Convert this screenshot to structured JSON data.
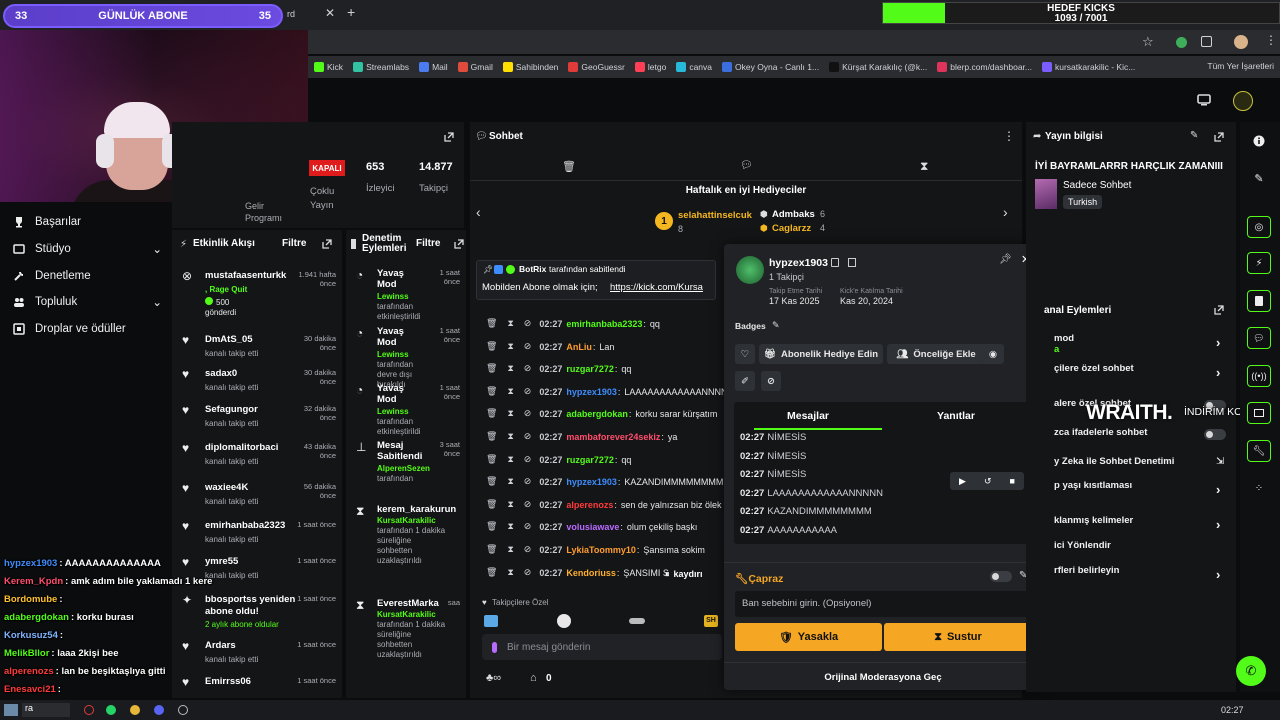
{
  "overlay": {
    "sub_goal": {
      "left": "33",
      "label": "GÜNLÜK ABONE",
      "right": "35"
    },
    "kick_goal": {
      "title": "HEDEF KICKS",
      "value": "1093 / 7001",
      "progress": 0.156,
      "color": "#53fc18"
    },
    "wraith": "WRAITH.",
    "discount": "İNDİRİM KOD"
  },
  "browser": {
    "tab_fragment": "rd",
    "bookmarks": [
      {
        "label": "Kick",
        "color": "#53fc18"
      },
      {
        "label": "Streamlabs",
        "color": "#31c3a2"
      },
      {
        "label": "Mail",
        "color": "#4a7cf0"
      },
      {
        "label": "Gmail",
        "color": "#e04b3b"
      },
      {
        "label": "Sahibinden",
        "color": "#ffe000"
      },
      {
        "label": "GeoGuessr",
        "color": "#e03b3b"
      },
      {
        "label": "letgo",
        "color": "#ff3f55"
      },
      {
        "label": "canva",
        "color": "#27b9d8"
      },
      {
        "label": "Okey Oyna - Canlı 1...",
        "color": "#3b6fe0"
      },
      {
        "label": "Kürşat Karakılıç (@k...",
        "color": "#111111"
      },
      {
        "label": "blerp.com/dashboar...",
        "color": "#e0335c"
      },
      {
        "label": "kursatkarakilic - Kic...",
        "color": "#7b5cff"
      }
    ],
    "all_bookmarks": "Tüm Yer İşaretleri"
  },
  "left_nav": {
    "items": [
      {
        "label": "Başarılar"
      },
      {
        "label": "Stüdyo"
      },
      {
        "label": "Denetleme"
      },
      {
        "label": "Topluluk"
      },
      {
        "label": "Droplar ve ödüller"
      }
    ]
  },
  "stats": {
    "status": "KAPALI",
    "viewers_value": "653",
    "viewers_label": "İzleyici",
    "followers_value": "14.877",
    "followers_label": "Takipçi",
    "income_l1": "Gelir",
    "income_l2": "Programı",
    "multi_l1": "Çoklu",
    "multi_l2": "Yayın"
  },
  "activity": {
    "title": "Etkinlik Akışı",
    "filter": "Filtre",
    "items": [
      {
        "name": "mustafaasenturkk",
        "sub": ", Rage Quit",
        "sub2": "500",
        "sub3": "gönderdi",
        "time": "1.941 hafta önce"
      },
      {
        "name": "DmAtS_05",
        "sub": "kanalı takip etti",
        "time": "30 dakika önce"
      },
      {
        "name": "sadax0",
        "sub": "kanalı takip etti",
        "time": "30 dakika önce"
      },
      {
        "name": "Sefagungor",
        "sub": "kanalı takip etti",
        "time": "32 dakika önce"
      },
      {
        "name": "diplomalitorbaci",
        "sub": "kanalı takip etti",
        "time": "43 dakika önce"
      },
      {
        "name": "waxiee4K",
        "sub": "kanalı takip etti",
        "time": "56 dakika önce"
      },
      {
        "name": "emirhanbaba2323",
        "sub": "kanalı takip etti",
        "time": "1 saat önce"
      },
      {
        "name": "ymre55",
        "sub": "kanalı takip etti",
        "time": "1 saat önce"
      },
      {
        "name": "bbosportss yeniden",
        "name2": "abone oldu!",
        "sub": "2 aylık abone oldular",
        "time": "1 saat önce"
      },
      {
        "name": "Ardars",
        "sub": "kanalı takip etti",
        "time": "1 saat önce"
      },
      {
        "name": "Emirrss06",
        "sub": "",
        "time": "1 saat önce"
      }
    ]
  },
  "mod_actions": {
    "title_l1": "Denetim",
    "title_l2": "Eylemleri",
    "filter": "Filtre",
    "items": [
      {
        "l1": "Yavaş",
        "l2": "Mod",
        "who": "Lewinss",
        "d1": "tarafından",
        "d2": "etkinleştirildi",
        "time": "1 saat önce"
      },
      {
        "l1": "Yavaş",
        "l2": "Mod",
        "who": "Lewinss",
        "d1": "tarafından",
        "d2": "devre dışı bırakıldı",
        "time": "1 saat önce"
      },
      {
        "l1": "Yavaş",
        "l2": "Mod",
        "who": "Lewinss",
        "d1": "tarafından",
        "d2": "etkinleştirildi",
        "time": "1 saat önce"
      },
      {
        "l1": "Mesaj",
        "l2": "Sabitlendi",
        "who": "AlperenSezen",
        "d1": "tarafından",
        "d2": "",
        "time": "3 saat önce"
      },
      {
        "l1": "kerem_karakurun",
        "l2": "",
        "who": "KursatKarakilic",
        "d1": "tarafından 1 dakika",
        "d2": "süreliğine sohbetten uzaklaştırıldı",
        "time": ""
      },
      {
        "l1": "EverestMarka",
        "l2": "",
        "who": "KursatKarakilic",
        "d1": "tarafından 1 dakika",
        "d2": "süreliğine sohbetten uzaklaştırıldı",
        "time": "saa"
      }
    ]
  },
  "chat": {
    "title": "Sohbet",
    "gifters_title": "Haftalık en iyi Hediyeciler",
    "gifters": [
      {
        "name": "selahattinselcuk",
        "count": "8"
      },
      {
        "name": "Admbaks",
        "count": "6"
      },
      {
        "name": "Caglarzz",
        "count": "4"
      }
    ],
    "pinned_by": "BotRix",
    "pinned_suffix": "tarafından sabitlendi",
    "pinned_text": "Mobilden Abone olmak için;",
    "pinned_link": "https://kick.com/Kursa",
    "messages": [
      {
        "time": "02:27",
        "user": "emirhanbaba2323",
        "color": "#53fc18",
        "text": "qq"
      },
      {
        "time": "02:27",
        "user": "AnLiu",
        "color": "#ff9d2e",
        "text": "Lan"
      },
      {
        "time": "02:27",
        "user": "ruzgar7272",
        "color": "#53fc18",
        "text": "qq"
      },
      {
        "time": "02:27",
        "user": "hypzex1903",
        "color": "#3e8dff",
        "text": "LAAAAAAAAAAAANNNN"
      },
      {
        "time": "02:27",
        "user": "adabergdokan",
        "color": "#53fc18",
        "text": "korku sarar kürşatım"
      },
      {
        "time": "02:27",
        "user": "mambaforever24sekiz",
        "color": "#ff4d6d",
        "text": "ya"
      },
      {
        "time": "02:27",
        "user": "ruzgar7272",
        "color": "#53fc18",
        "text": "qq"
      },
      {
        "time": "02:27",
        "user": "hypzex1903",
        "color": "#3e8dff",
        "text": "KAZANDIMMMMMMMM"
      },
      {
        "time": "02:27",
        "user": "alperenozs",
        "color": "#ff3b3b",
        "text": "sen de yalnızsan biz ölek"
      },
      {
        "time": "02:27",
        "user": "volusiawave",
        "color": "#b96bff",
        "text": "olum çekiliş başkı"
      },
      {
        "time": "02:27",
        "user": "LykiaToommy10",
        "color": "#ff9d2e",
        "text": "Şansıma sokim"
      },
      {
        "time": "02:27",
        "user": "Kendoriuss",
        "color": "#ffb02e",
        "text": "ŞANSIMI S"
      }
    ],
    "paused": "kaydırı",
    "followers_only": "Takipçilere Özel",
    "input_placeholder": "Bir mesaj gönderin",
    "points": "0"
  },
  "user_card": {
    "username": "hypzex1903",
    "followers": "1 Takipçi",
    "follow_date_label": "Takip Etme Tarihi",
    "follow_date": "17 Kas 2025",
    "join_label": "Kick'e Katılma Tarihi",
    "join_date": "Kas 20, 2024",
    "badges": "Badges",
    "gift_sub": "Abonelik Hediye Edin",
    "priority": "Önceliğe Ekle",
    "tab_messages": "Mesajlar",
    "tab_replies": "Yanıtlar",
    "messages": [
      {
        "time": "02:27",
        "text": "NİMESİS"
      },
      {
        "time": "02:27",
        "text": "NİMESİS"
      },
      {
        "time": "02:27",
        "text": "NİMESİS"
      },
      {
        "time": "02:27",
        "text": "LAAAAAAAAAAAANNNNN"
      },
      {
        "time": "02:27",
        "text": "KAZANDIMMMMMMMM"
      },
      {
        "time": "02:27",
        "text": "AAAAAAAAAAA"
      }
    ],
    "cross_title": "Çapraz",
    "ban_placeholder": "Ban sebebini girin. (Opsiyonel)",
    "ban_btn": "Yasakla",
    "timeout_btn": "Sustur",
    "original_mod": "Orijinal Moderasyona Geç"
  },
  "info": {
    "title": "Yayın bilgisi",
    "stream_title": "İYİ BAYRAMLARRR HARÇLIK ZAMANIII",
    "category": "Sadece Sohbet",
    "language": "Turkish",
    "channel_actions": "anal Eylemleri",
    "rows": [
      {
        "l1": "mod",
        "l2": "a",
        "kind": "chev"
      },
      {
        "l1": "çilere özel sohbet",
        "kind": "chev"
      },
      {
        "l1": "alere özel sohbet",
        "kind": "toggle"
      },
      {
        "l1": "zca ifadelerle sohbet",
        "kind": "toggle"
      },
      {
        "l1": "y Zeka ile Sohbet Denetimi",
        "kind": "ext"
      },
      {
        "l1": "p yaşı kısıtlaması",
        "kind": "chev"
      },
      {
        "l1": "klanmış kelimeler",
        "kind": "chev"
      },
      {
        "l1": "ici Yönlendir",
        "kind": "none"
      },
      {
        "l1": "rfleri belirleyin",
        "kind": "chev"
      }
    ]
  },
  "stream_chat": [
    {
      "user": "hypzex1903",
      "color": "#3e8dff",
      "text": "AAAAAAAAAAAAAA"
    },
    {
      "user": "Kerem_Kpdn",
      "color": "#ff4d6d",
      "text": "amk adım bile yaklamadı 1 kere"
    },
    {
      "user": "Bordomube",
      "color": "#ffc22e",
      "text": ""
    },
    {
      "user": "adabergdokan",
      "color": "#53fc18",
      "text": "korku burası"
    },
    {
      "user": "Korkusuz54",
      "color": "#7fb3ff",
      "text": ""
    },
    {
      "user": "MelikBllor",
      "color": "#53fc18",
      "text": "laaa 2kişi bee"
    },
    {
      "user": "alperenozs",
      "color": "#ff3b3b",
      "text": "lan be beşiktaşlıya gitti"
    },
    {
      "user": "Enesavci21",
      "color": "#ff3b3b",
      "text": ""
    }
  ],
  "taskbar": {
    "time": "02:27",
    "search": "ra"
  }
}
